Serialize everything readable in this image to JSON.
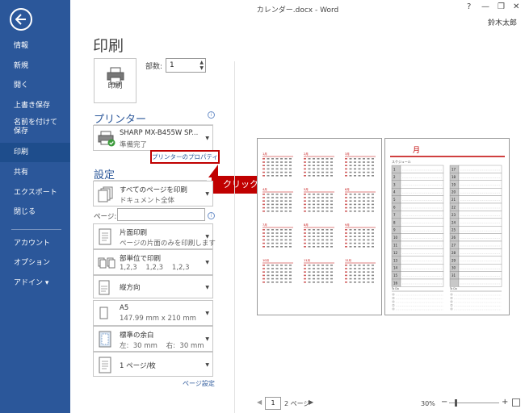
{
  "window": {
    "title": "カレンダー.docx - Word",
    "help": "?",
    "minimize": "—",
    "restore": "❐",
    "close": "✕",
    "user": "鈴木太郎"
  },
  "sidebar": {
    "items": [
      {
        "label": "情報"
      },
      {
        "label": "新規"
      },
      {
        "label": "開く"
      },
      {
        "label": "上書き保存"
      },
      {
        "label": "名前を付けて",
        "label2": "保存"
      },
      {
        "label": "印刷"
      },
      {
        "label": "共有"
      },
      {
        "label": "エクスポート"
      },
      {
        "label": "閉じる"
      },
      {
        "label": "アカウント"
      },
      {
        "label": "オプション"
      },
      {
        "label": "アドイン ▾"
      }
    ]
  },
  "print": {
    "heading": "印刷",
    "button_label": "印刷",
    "copies_label": "部数:",
    "copies_value": "1"
  },
  "printer": {
    "section_title": "プリンター",
    "name": "SHARP MX-B455W SP...",
    "status": "準備完了",
    "properties_link": "プリンターのプロパティ",
    "callout": "クリック"
  },
  "settings": {
    "section_title": "設定",
    "range_title": "すべてのページを印刷",
    "range_sub": "ドキュメント全体",
    "pages_label": "ページ:",
    "pages_value": "",
    "sides_title": "片面印刷",
    "sides_sub": "ページの片面のみを印刷します",
    "collate_title": "部単位で印刷",
    "collate_sub": "1,2,3    1,2,3    1,2,3",
    "orientation": "縦方向",
    "paper_title": "A5",
    "paper_sub": "147.99 mm x 210 mm",
    "margins_title": "標準の余白",
    "margins_sub": "左:  30 mm    右:  30 mm",
    "per_sheet": "1 ページ/枚",
    "page_setup_link": "ページ設定"
  },
  "preview": {
    "page_current": "1",
    "page_total": "2 ページ",
    "zoom": "30%",
    "month_title": "月",
    "schedule_label": "スケジュール",
    "todo_label": "To Do",
    "month_labels": [
      "1月",
      "2月",
      "3月",
      "4月",
      "5月",
      "6月",
      "7月",
      "8月",
      "9月",
      "10月",
      "11月",
      "12月"
    ]
  },
  "colors": {
    "accent": "#2b579a",
    "callout": "#c00000"
  }
}
